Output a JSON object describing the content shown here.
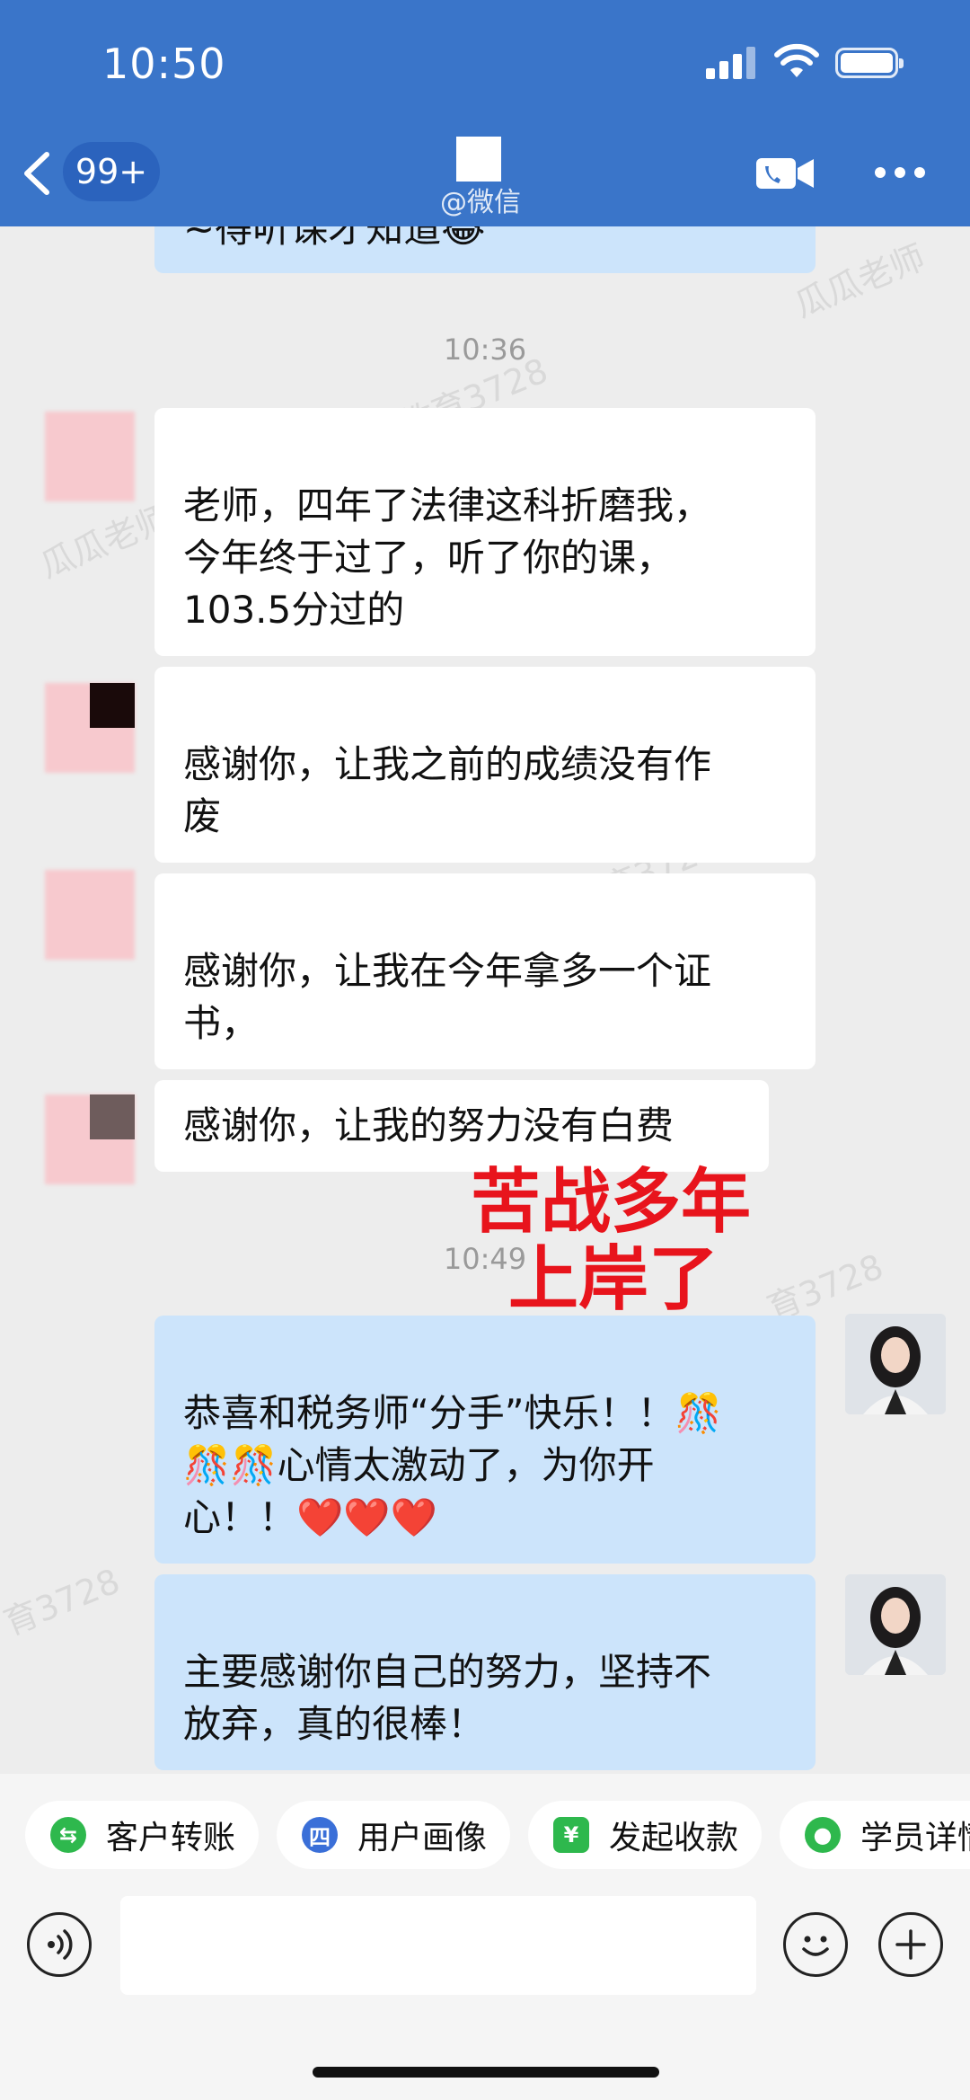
{
  "status_bar": {
    "time": "10:50"
  },
  "header": {
    "unread_badge": "99+",
    "subtitle": "@微信",
    "colors": {
      "header_bg": "#3a75c9",
      "badge_bg": "#2b63bd"
    }
  },
  "chat": {
    "partial_top_message": "~得听课才知道😂",
    "time_1": "10:36",
    "time_2": "10:49",
    "incoming": [
      {
        "text": "老师，四年了法律这科折磨我，\n今年终于过了，听了你的课，\n103.5分过的"
      },
      {
        "text": "感谢你，让我之前的成绩没有作\n废"
      },
      {
        "text": "感谢你，让我在今年拿多一个证\n书，"
      },
      {
        "text": "感谢你，让我的努力没有白费"
      }
    ],
    "outgoing": [
      {
        "text": "恭喜和税务师“分手”快乐！！🎊\n🎊🎊心情太激动了，为你开\n心！！❤️❤️❤️"
      },
      {
        "text": "主要感谢你自己的努力，坚持不\n放弃，真的很棒！"
      }
    ],
    "annotation_line1": "苦战多年",
    "annotation_line2": "上岸了",
    "watermarks": [
      "瓜瓜老师",
      "教育3728",
      "瓜瓜老师",
      "教育3728",
      "育3728",
      "育3728"
    ],
    "colors": {
      "incoming_bubble": "#ffffff",
      "outgoing_bubble": "#cce4fb",
      "annotation": "#e8141c"
    }
  },
  "quick_actions": [
    {
      "label": "客户转账",
      "icon": "transfer-icon",
      "color": "#2eb84d"
    },
    {
      "label": "用户画像",
      "icon": "profile-icon",
      "color": "#3a6fd8"
    },
    {
      "label": "发起收款",
      "icon": "payment-icon",
      "color": "#2eb84d"
    },
    {
      "label": "学员详情",
      "icon": "student-icon",
      "color": "#2eb84d"
    }
  ],
  "input_bar": {
    "placeholder": ""
  }
}
